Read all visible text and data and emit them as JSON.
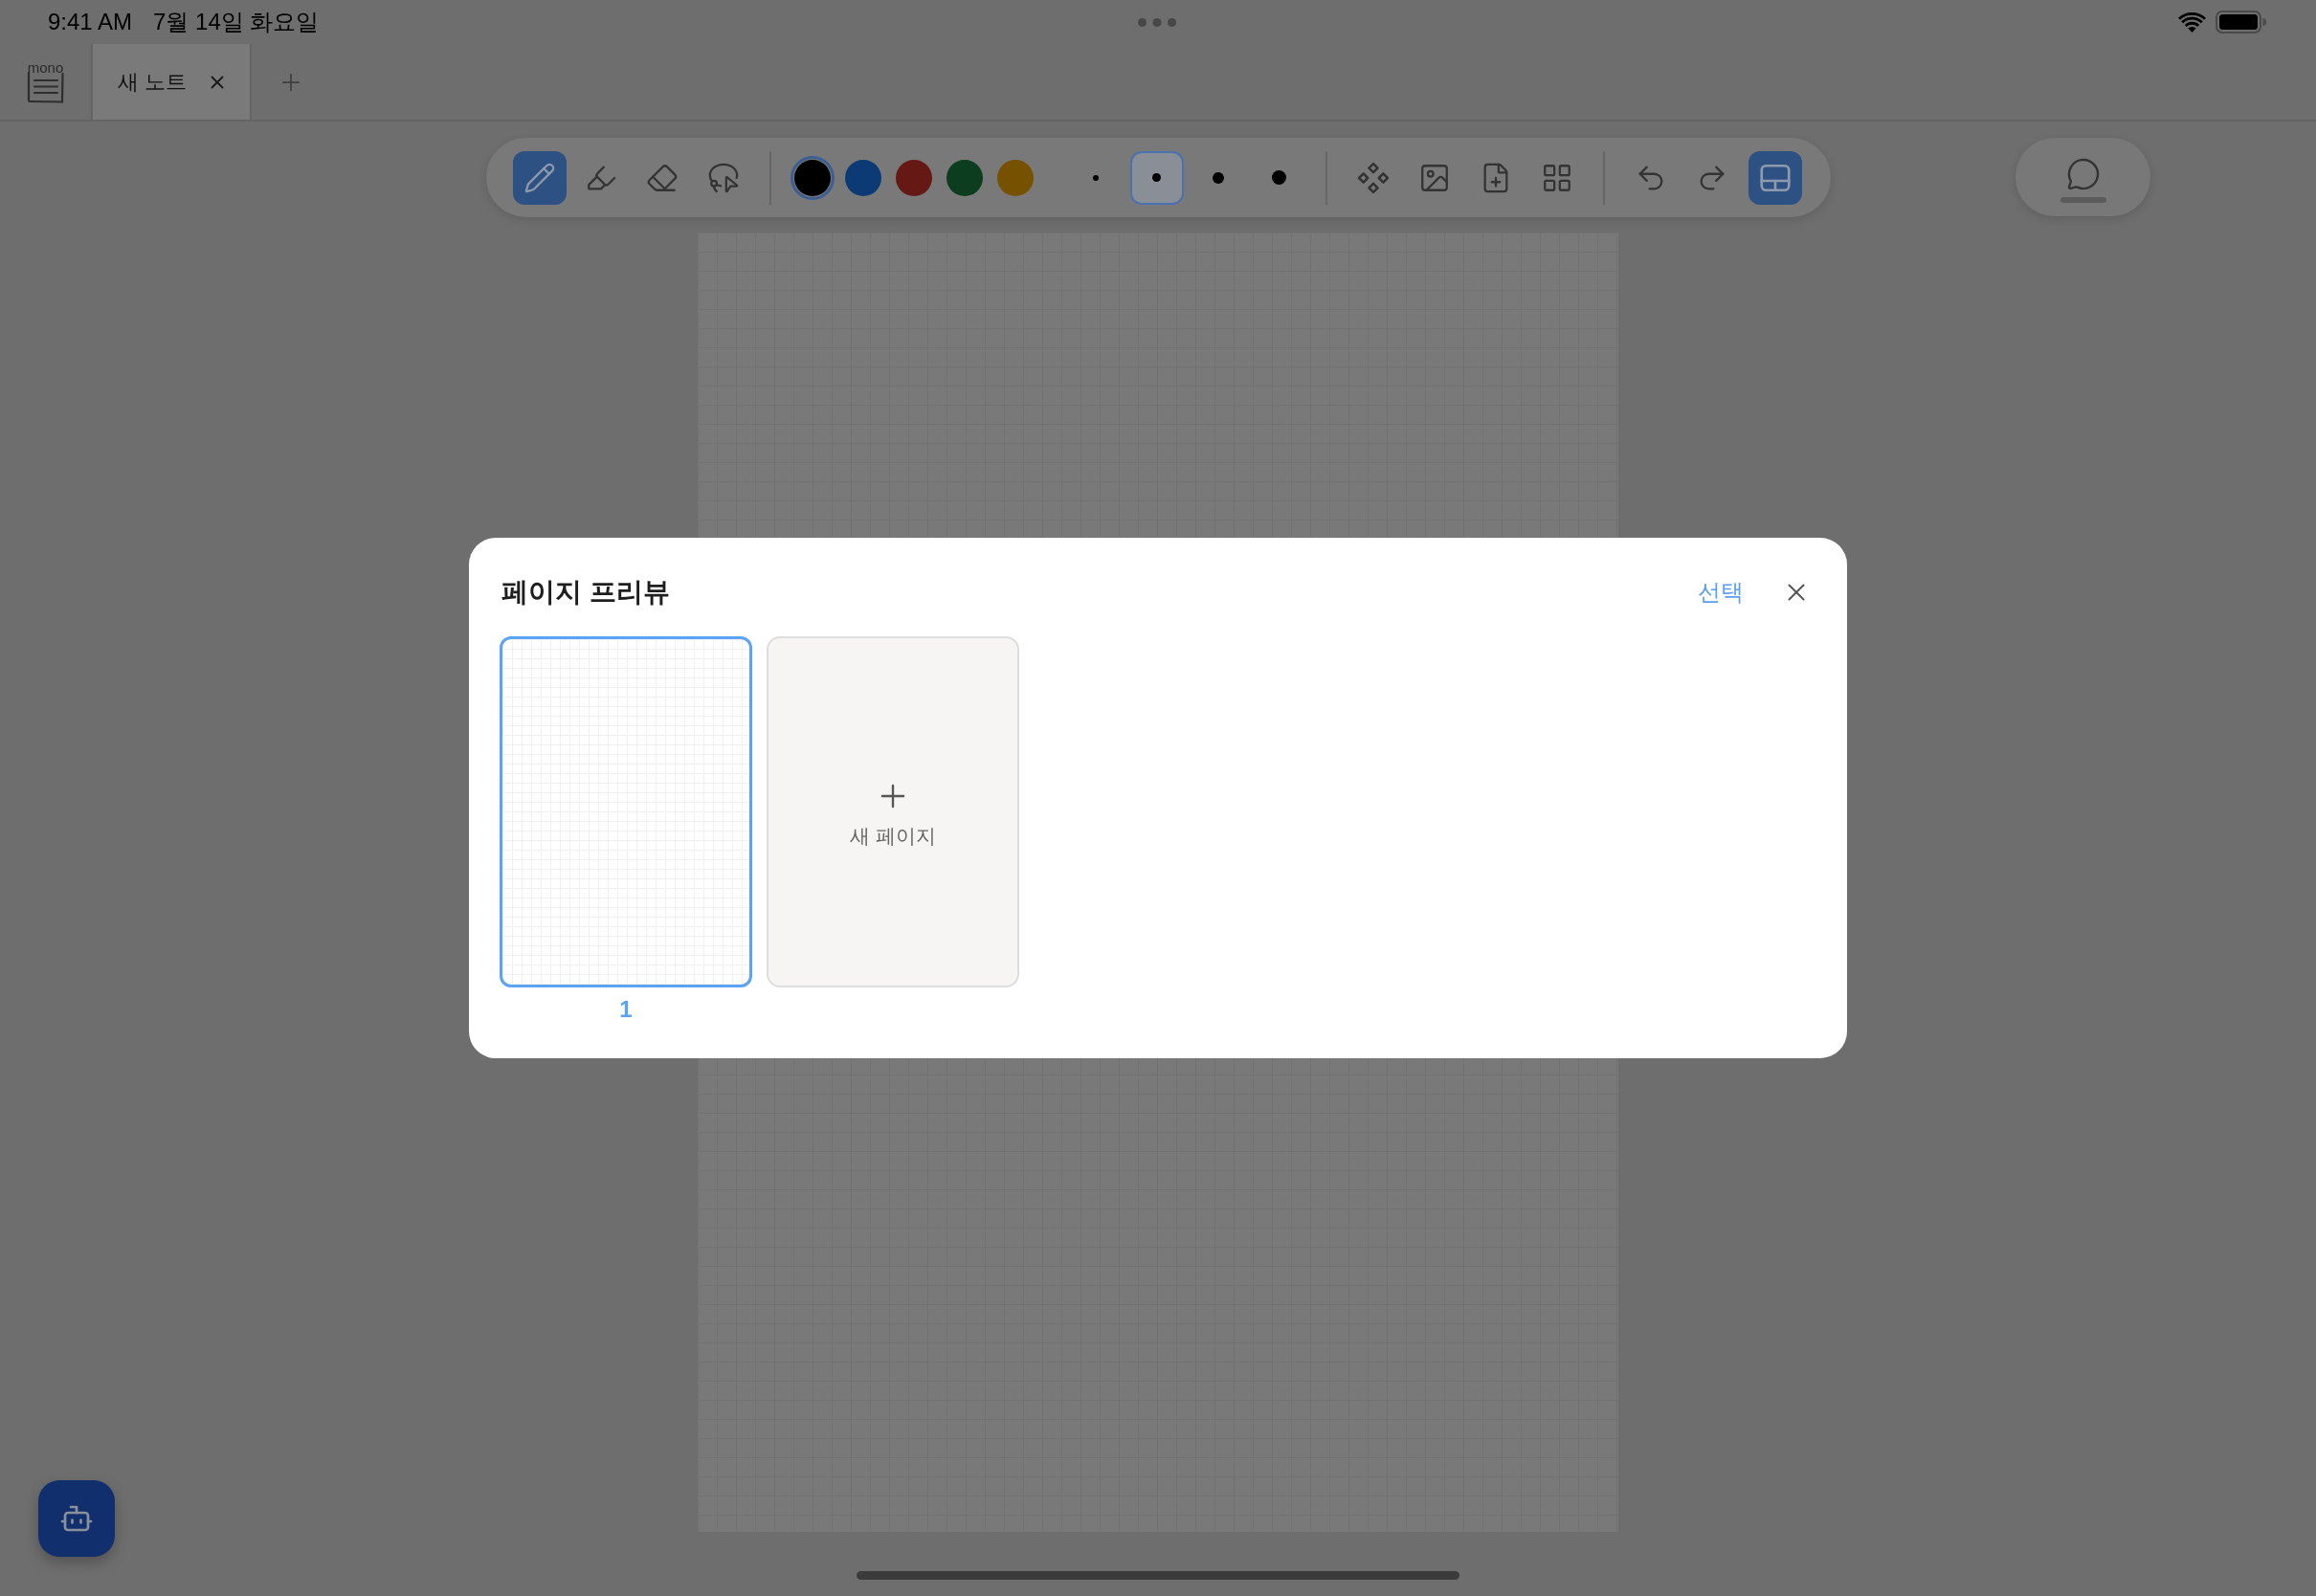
{
  "status_bar": {
    "time": "9:41 AM",
    "date": "7월 14일 화요일"
  },
  "tab_bar": {
    "logo_text": "mono",
    "tabs": [
      {
        "label": "새 노트",
        "selected": true
      }
    ]
  },
  "toolbar": {
    "tools": [
      {
        "kind": "pen",
        "selected": true
      },
      {
        "kind": "highlighter",
        "selected": false
      },
      {
        "kind": "eraser",
        "selected": false
      },
      {
        "kind": "lasso",
        "selected": false
      }
    ],
    "colors": [
      {
        "color": "#000000",
        "selected": true
      },
      {
        "color": "#0c3a74",
        "selected": false
      },
      {
        "color": "#661914",
        "selected": false
      },
      {
        "color": "#0c3d1e",
        "selected": false
      },
      {
        "color": "#765200",
        "selected": false
      }
    ],
    "pen_sizes": [
      {
        "selected": false
      },
      {
        "selected": true
      },
      {
        "selected": false
      },
      {
        "selected": false
      }
    ],
    "insert_tools": [
      {
        "kind": "shapes"
      },
      {
        "kind": "image"
      },
      {
        "kind": "add-page"
      },
      {
        "kind": "grid"
      }
    ],
    "history": [
      {
        "kind": "undo"
      },
      {
        "kind": "redo"
      }
    ],
    "layout_toggle": {
      "on": true
    }
  },
  "modal": {
    "title": "페이지 프리뷰",
    "select_link": "선택",
    "pages": [
      {
        "number": "1",
        "selected": true
      }
    ],
    "new_page": {
      "label": "새 페이지"
    }
  }
}
